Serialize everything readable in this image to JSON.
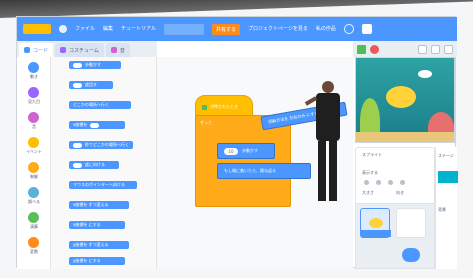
{
  "menubar": {
    "items": [
      "ファイル",
      "編集",
      "チュートリアル"
    ],
    "share": "共有する",
    "project_page": "プロジェクトページを見る",
    "my_stuff": "私の作品"
  },
  "tabs": [
    {
      "label": "コード"
    },
    {
      "label": "コスチューム"
    },
    {
      "label": "音"
    }
  ],
  "categories": [
    {
      "label": "動き",
      "color": "#4c97ff"
    },
    {
      "label": "見た目",
      "color": "#9966ff"
    },
    {
      "label": "音",
      "color": "#cf63cf"
    },
    {
      "label": "イベント",
      "color": "#ffbf00"
    },
    {
      "label": "制御",
      "color": "#ffab19"
    },
    {
      "label": "調べる",
      "color": "#5cb1d6"
    },
    {
      "label": "演算",
      "color": "#59c059"
    },
    {
      "label": "変数",
      "color": "#ff8c1a"
    }
  ],
  "palette_blocks": [
    {
      "label": "歩動かす"
    },
    {
      "label": "度回す"
    },
    {
      "label": "どこかの場所へ行く"
    },
    {
      "label": "x座標を"
    },
    {
      "label": "秒でどこかの場所へ行く"
    },
    {
      "label": "度に向ける"
    },
    {
      "label": "マウスのポインターへ向ける"
    },
    {
      "label": "x座標を ずつ変える"
    },
    {
      "label": "x座標を にする"
    },
    {
      "label": "y座標を ずつ変える"
    },
    {
      "label": "y座標を にする"
    }
  ],
  "script": {
    "hat_label": "が押されたとき",
    "loop_label": "ずっと",
    "move_label": "歩動かす",
    "move_value": "10",
    "edge_label": "もし端に着いたら、跳ね返る"
  },
  "dragging_block": "回転方法を 左右のみ にする",
  "sprite_info": {
    "label_sprite": "スプライト",
    "label_show": "表示する",
    "label_size": "大きさ",
    "label_direction": "向き"
  },
  "right_panel": {
    "label_stage": "ステージ",
    "label_backdrop": "背景"
  }
}
